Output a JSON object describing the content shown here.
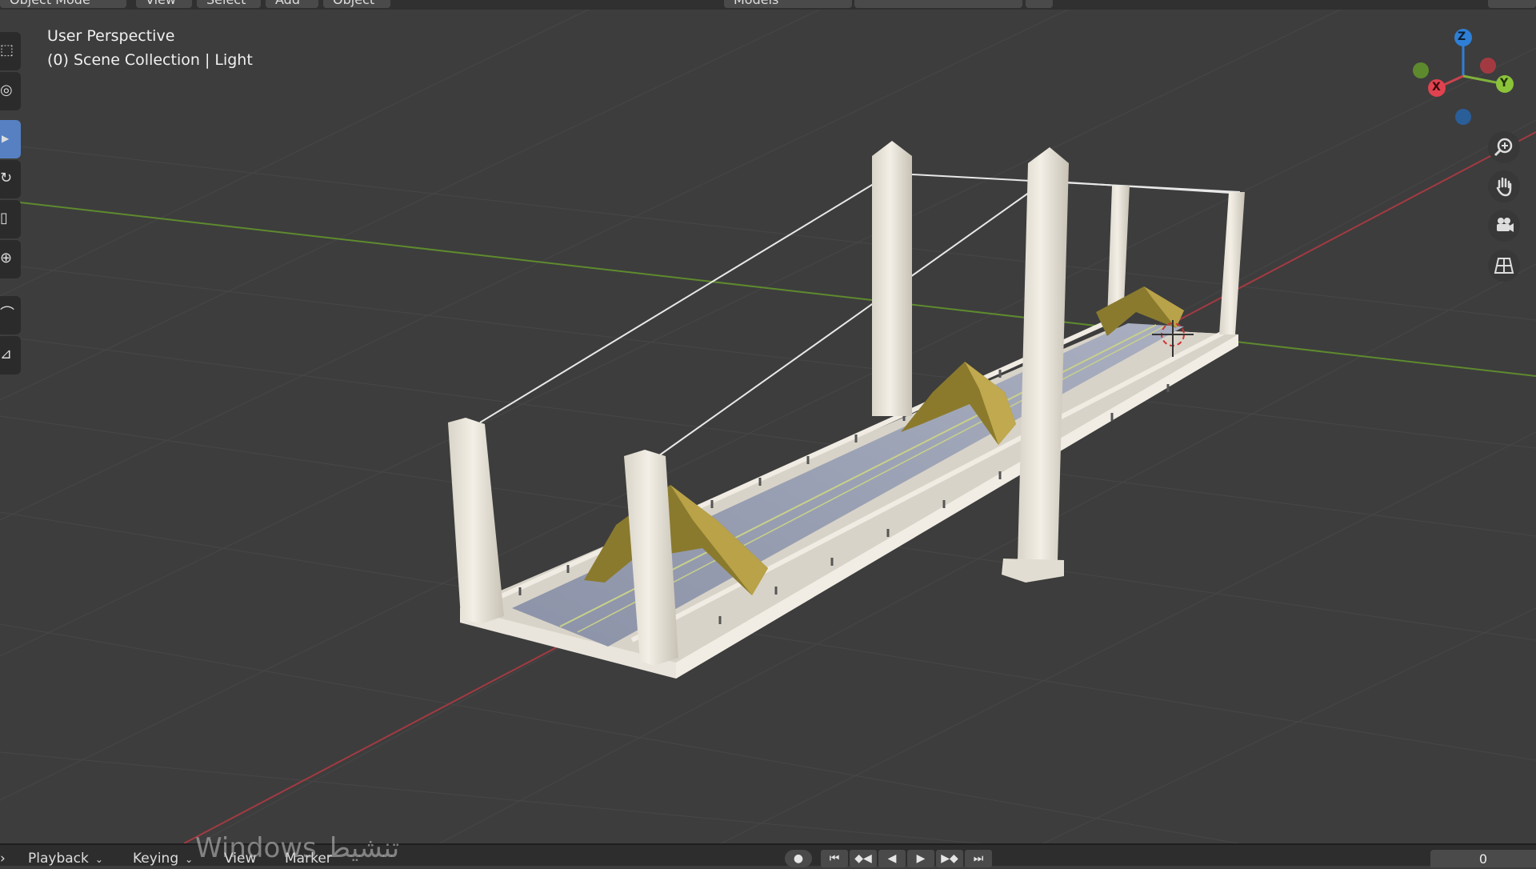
{
  "header": {
    "mode_menu": "Object Mode",
    "menus": [
      "View",
      "Select",
      "Add",
      "Object"
    ],
    "collection_filter": "Models"
  },
  "viewport": {
    "perspective_label": "User Perspective",
    "collection_label": "(0) Scene Collection | Light",
    "gizmo": {
      "z": "Z",
      "x": "X",
      "y": "Y"
    },
    "colors": {
      "x_axis": "#c9434d",
      "y_axis": "#7fb23a",
      "z_axis": "#2e7fd6",
      "grid": "#454545",
      "background": "#3d3d3d"
    }
  },
  "toolbar": {
    "tools": [
      "select-box",
      "cursor",
      "move",
      "rotate",
      "scale",
      "transform",
      "annotate",
      "measure"
    ],
    "active_tool": "move"
  },
  "nav_buttons": [
    "zoom-icon",
    "pan-hand-icon",
    "camera-view-icon",
    "ortho-grid-icon"
  ],
  "timeline": {
    "menus": [
      "Playback",
      "Keying",
      "View",
      "Marker"
    ],
    "current_frame": "0"
  },
  "watermark": {
    "text": "Windows تنشيط"
  }
}
